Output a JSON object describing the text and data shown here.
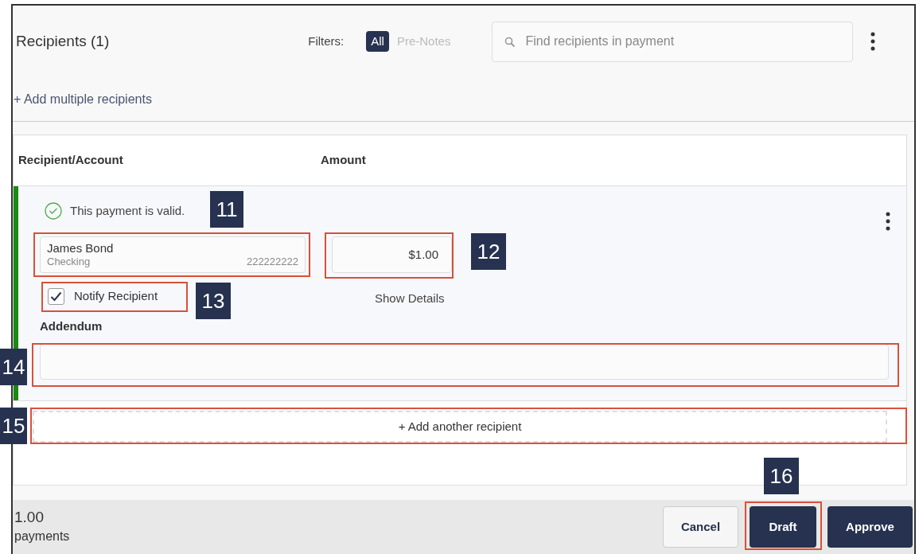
{
  "header": {
    "title": "Recipients (1)",
    "filters_label": "Filters:",
    "filters": [
      {
        "label": "All",
        "selected": true
      },
      {
        "label": "Pre-Notes",
        "selected": false
      }
    ],
    "search": {
      "placeholder": "Find recipients in payment"
    },
    "add_multiple": "+ Add multiple recipients"
  },
  "table": {
    "columns": [
      "Recipient/Account",
      "Amount"
    ],
    "rows": [
      {
        "valid": true,
        "status": "This payment is valid.",
        "name": "James Bond",
        "account_type": "Checking",
        "account_number": "222222222",
        "amount": "$1.00",
        "notify": {
          "label": "Notify Recipient",
          "checked": true
        },
        "show_details": "Show Details",
        "addendum_label": "Addendum"
      }
    ],
    "add_another": "+ Add another recipient"
  },
  "footer": {
    "total": "1.00",
    "count": "payments",
    "buttons": [
      {
        "label": "Cancel",
        "kind": "secondary"
      },
      {
        "label": "Draft",
        "kind": "primary"
      },
      {
        "label": "Approve",
        "kind": "primary"
      }
    ]
  },
  "callouts": [
    {
      "label": "11"
    },
    {
      "label": "12"
    },
    {
      "label": "13"
    },
    {
      "label": "14"
    },
    {
      "label": "15"
    },
    {
      "label": "16"
    }
  ]
}
